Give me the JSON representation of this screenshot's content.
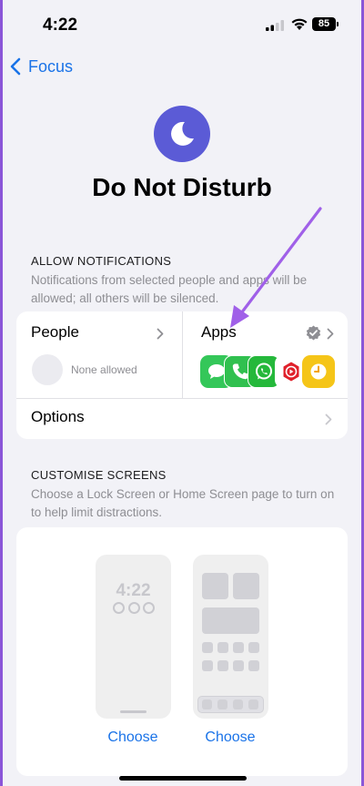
{
  "status_bar": {
    "time": "4:22",
    "battery": "85"
  },
  "nav": {
    "back_label": "Focus"
  },
  "header": {
    "title": "Do Not Disturb",
    "icon": "moon-icon",
    "icon_color": "#5b5bd6"
  },
  "allow_notifications": {
    "heading": "ALLOW NOTIFICATIONS",
    "description": "Notifications from selected people and apps will be allowed; all others will be silenced.",
    "people": {
      "label": "People",
      "status": "None allowed"
    },
    "apps": {
      "label": "Apps",
      "icons": [
        "messages-icon",
        "phone-icon",
        "whatsapp-icon",
        "youtube-music-icon",
        "clock-app-icon"
      ]
    },
    "options_label": "Options"
  },
  "customise_screens": {
    "heading": "CUSTOMISE SCREENS",
    "description": "Choose a Lock Screen or Home Screen page to turn on to help limit distractions.",
    "lock_preview_time": "4:22",
    "lock_choose_label": "Choose",
    "home_choose_label": "Choose"
  },
  "colors": {
    "accent": "#1a73e8",
    "frame": "#8b56d8",
    "annotation_arrow": "#a060e8"
  }
}
